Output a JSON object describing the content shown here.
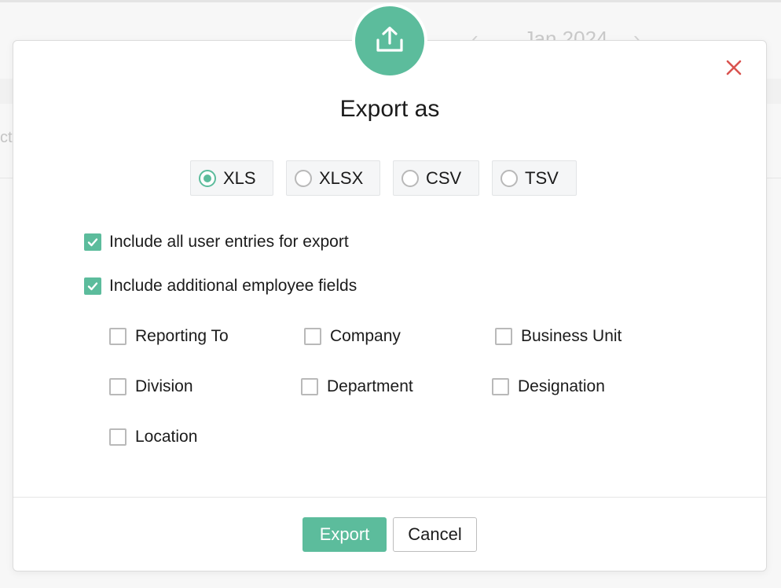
{
  "background": {
    "month_label": "Jan 2024",
    "prev_chevron": "‹",
    "next_chevron": "›",
    "fragment_text": "ct"
  },
  "dialog": {
    "title": "Export as",
    "header_icon": "upload-icon",
    "close_icon": "close-icon",
    "accent_color": "#5cbc9c",
    "close_color": "#d9534f",
    "formats": [
      {
        "label": "XLS",
        "selected": true
      },
      {
        "label": "XLSX",
        "selected": false
      },
      {
        "label": "CSV",
        "selected": false
      },
      {
        "label": "TSV",
        "selected": false
      }
    ],
    "options": [
      {
        "label": "Include all user entries for export",
        "checked": true
      },
      {
        "label": "Include additional employee fields",
        "checked": true
      }
    ],
    "fields": [
      {
        "label": "Reporting To",
        "checked": false
      },
      {
        "label": "Company",
        "checked": false
      },
      {
        "label": "Business Unit",
        "checked": false
      },
      {
        "label": "Division",
        "checked": false
      },
      {
        "label": "Department",
        "checked": false
      },
      {
        "label": "Designation",
        "checked": false
      },
      {
        "label": "Location",
        "checked": false
      }
    ],
    "buttons": {
      "export_label": "Export",
      "cancel_label": "Cancel"
    }
  }
}
